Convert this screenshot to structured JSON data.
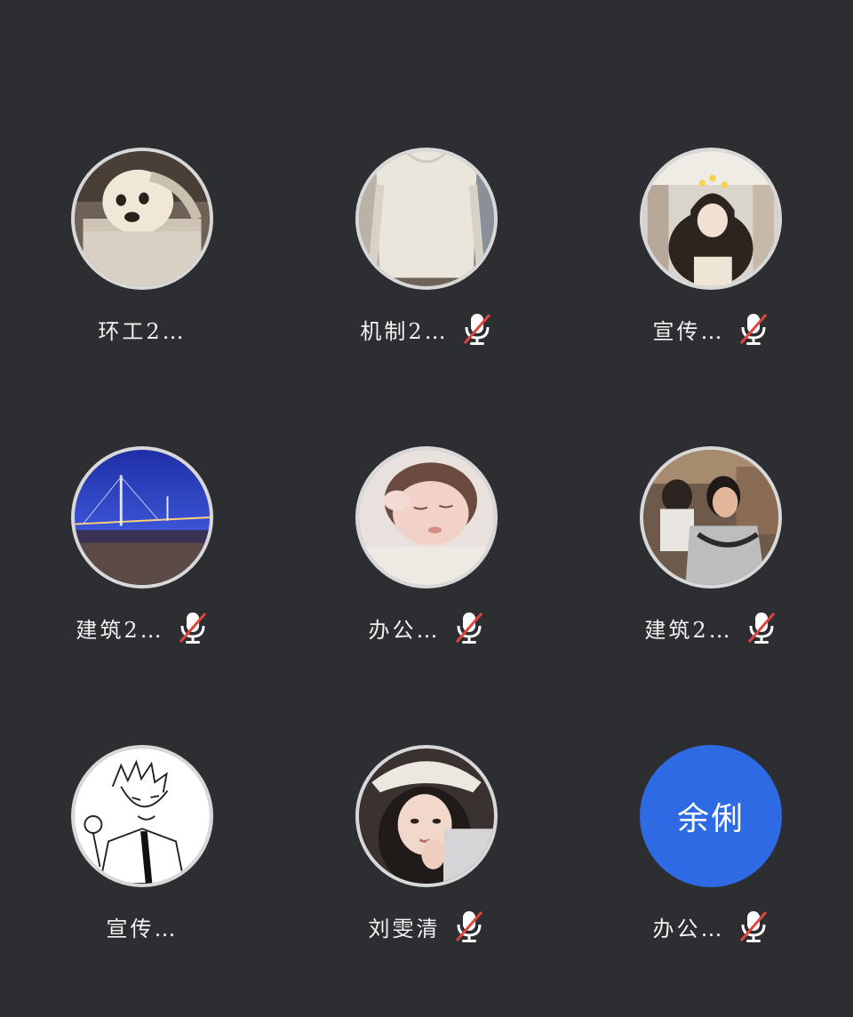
{
  "participants": [
    {
      "name": "环工2…",
      "muted": false,
      "avatar": "dog-in-bag-photo"
    },
    {
      "name": "机制2…",
      "muted": true,
      "avatar": "person-in-white-shirt-photo"
    },
    {
      "name": "宣传…",
      "muted": true,
      "avatar": "girl-with-flower-crown-photo"
    },
    {
      "name": "建筑2…",
      "muted": true,
      "avatar": "bridge-at-night-photo"
    },
    {
      "name": "办公…",
      "muted": true,
      "avatar": "sleeping-baby-photo"
    },
    {
      "name": "建筑2…",
      "muted": true,
      "avatar": "boy-in-restaurant-photo"
    },
    {
      "name": "宣传…",
      "muted": false,
      "avatar": "anime-sketch-drawing"
    },
    {
      "name": "刘雯清",
      "muted": true,
      "avatar": "girl-in-cap-photo"
    },
    {
      "name": "办公…",
      "muted": true,
      "avatar_text": "余俐",
      "avatar_color": "#2f6ae5"
    }
  ],
  "colors": {
    "background": "#2d2e31",
    "avatar_border": "#d8d8d8",
    "mute_slash": "#e0453a",
    "text": "#f2f2f2"
  },
  "icons": {
    "muted": "microphone-muted-icon"
  }
}
